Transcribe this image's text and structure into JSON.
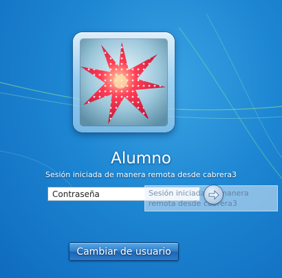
{
  "user": {
    "name": "Alumno",
    "session_status": "Sesión iniciada de manera remota desde cabrera3"
  },
  "password": {
    "value": "",
    "placeholder": "Contraseña"
  },
  "tooltip": {
    "text": "Sesión iniciada de manera remota desde cabrera3"
  },
  "submit": {
    "icon": "arrow-right-icon"
  },
  "switch_user": {
    "label": "Cambiar de usuario"
  },
  "colors": {
    "background": "#1d86d2",
    "avatar_star": "#e8174a"
  }
}
